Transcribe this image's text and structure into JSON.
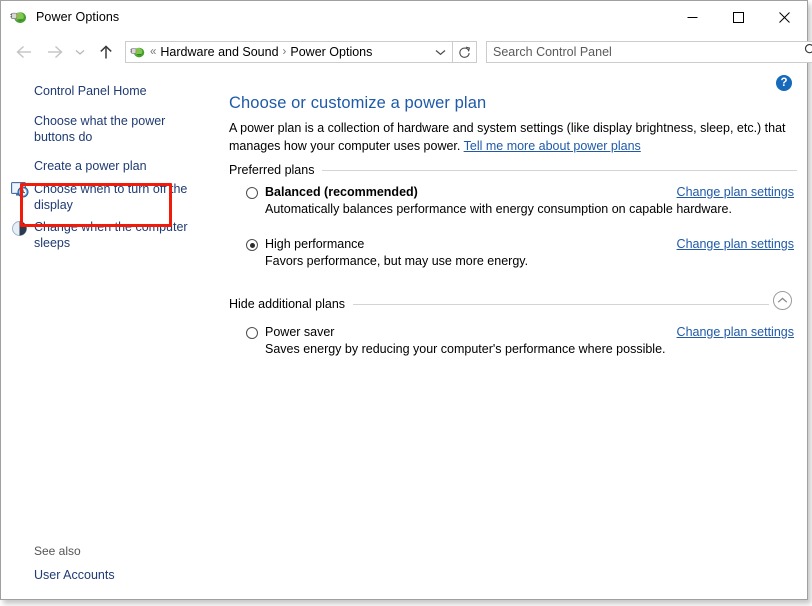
{
  "window": {
    "title": "Power Options",
    "app_icon": "power-plug-icon",
    "controls": {
      "minimize": "Minimize",
      "maximize": "Maximize",
      "close": "Close"
    }
  },
  "navigation": {
    "back": "Back",
    "forward": "Forward",
    "recent_locations": "Recent locations",
    "up": "Up",
    "refresh": "Refresh",
    "breadcrumb": {
      "icon": "power-plug-icon",
      "overflow": "«",
      "separator": "›",
      "items": [
        "Hardware and Sound",
        "Power Options"
      ],
      "dropdown": "Previous locations"
    }
  },
  "search": {
    "placeholder": "Search Control Panel",
    "value": "",
    "icon": "search-icon"
  },
  "sidebar": {
    "home_label": "Control Panel Home",
    "links": [
      {
        "label": "Choose what the power buttons do",
        "icon": null,
        "highlighted": true
      },
      {
        "label": "Create a power plan",
        "icon": null,
        "highlighted": false
      },
      {
        "label": "Choose when to turn off the display",
        "icon": "monitor-clock-icon",
        "highlighted": false
      },
      {
        "label": "Change when the computer sleeps",
        "icon": "moon-icon",
        "highlighted": false
      }
    ],
    "see_also_label": "See also",
    "see_also_links": [
      "User Accounts"
    ]
  },
  "main": {
    "help_label": "?",
    "title": "Choose or customize a power plan",
    "description_part1": "A power plan is a collection of hardware and system settings (like display brightness, sleep, etc.) that manages how your computer uses power. ",
    "description_link": "Tell me more about power plans",
    "preferred_group_label": "Preferred plans",
    "additional_group_label": "Hide additional plans",
    "collapse_icon": "chevron-up-icon",
    "change_link_label": "Change plan settings",
    "plans": [
      {
        "name": "Balanced (recommended)",
        "description": "Automatically balances performance with energy consumption on capable hardware.",
        "selected": false,
        "bold": true
      },
      {
        "name": "High performance",
        "description": "Favors performance, but may use more energy.",
        "selected": true,
        "bold": false
      },
      {
        "name": "Power saver",
        "description": "Saves energy by reducing your computer's performance where possible.",
        "selected": false,
        "bold": false
      }
    ]
  },
  "colors": {
    "link": "#1f5aa8",
    "sidebar_link": "#1f3b73",
    "highlight_box": "#f21a09",
    "help_blue": "#1669bb",
    "window_border": "#a0a0a0",
    "rule": "#d4d4d4"
  }
}
